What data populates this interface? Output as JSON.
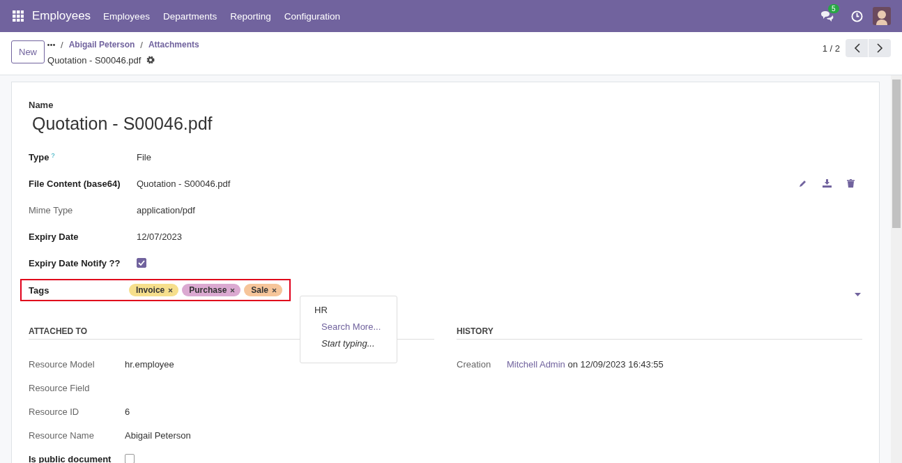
{
  "navbar": {
    "app_name": "Employees",
    "menu": [
      "Employees",
      "Departments",
      "Reporting",
      "Configuration"
    ],
    "chat_count": "5"
  },
  "control_panel": {
    "new_button": "New",
    "breadcrumbs": [
      {
        "separator": "/",
        "label": "Abigail Peterson"
      },
      {
        "separator": "/",
        "label": "Attachments"
      }
    ],
    "record_title": "Quotation - S00046.pdf",
    "pager": "1 / 2"
  },
  "form": {
    "name_label": "Name",
    "name": "Quotation - S00046.pdf",
    "fields": [
      {
        "label": "Type",
        "kind": "text",
        "help": "?",
        "value": "File",
        "readonly": false
      },
      {
        "label": "File Content (base64)",
        "kind": "file",
        "value": "Quotation - S00046.pdf",
        "readonly": false
      },
      {
        "label": "Mime Type",
        "kind": "text",
        "value": "application/pdf",
        "readonly": true
      },
      {
        "label": "Expiry Date",
        "kind": "text",
        "value": "12/07/2023",
        "readonly": false
      },
      {
        "label": "Expiry Date Notify ??",
        "kind": "checkbox",
        "checked": true,
        "readonly": false
      },
      {
        "label": "Tags",
        "kind": "tags",
        "highlighted": true,
        "readonly": false,
        "tags": [
          {
            "label": "Invoice",
            "color": "#f6df8c"
          },
          {
            "label": "Purchase",
            "color": "#dba9d1"
          },
          {
            "label": "Sale",
            "color": "#f6c59a"
          }
        ]
      }
    ],
    "dropdown": [
      {
        "label": "HR",
        "kind": "option"
      },
      {
        "label": "Search More...",
        "kind": "action"
      },
      {
        "label": "Start typing...",
        "kind": "hint"
      }
    ],
    "attached_to": {
      "title": "ATTACHED TO",
      "fields": [
        {
          "label": "Resource Model",
          "kind": "text",
          "value": "hr.employee",
          "readonly": true
        },
        {
          "label": "Resource Field",
          "kind": "text",
          "readonly": true
        },
        {
          "label": "Resource ID",
          "kind": "text",
          "value": "6",
          "readonly": true
        },
        {
          "label": "Resource Name",
          "kind": "text",
          "value": "Abigail Peterson",
          "readonly": true
        },
        {
          "label": "Is public document",
          "kind": "checkbox",
          "checked": false,
          "readonly": false
        }
      ]
    },
    "history": {
      "title": "HISTORY",
      "label": "Creation",
      "author": "Mitchell Admin",
      "detail": "on 12/09/2023 16:43:55"
    }
  }
}
